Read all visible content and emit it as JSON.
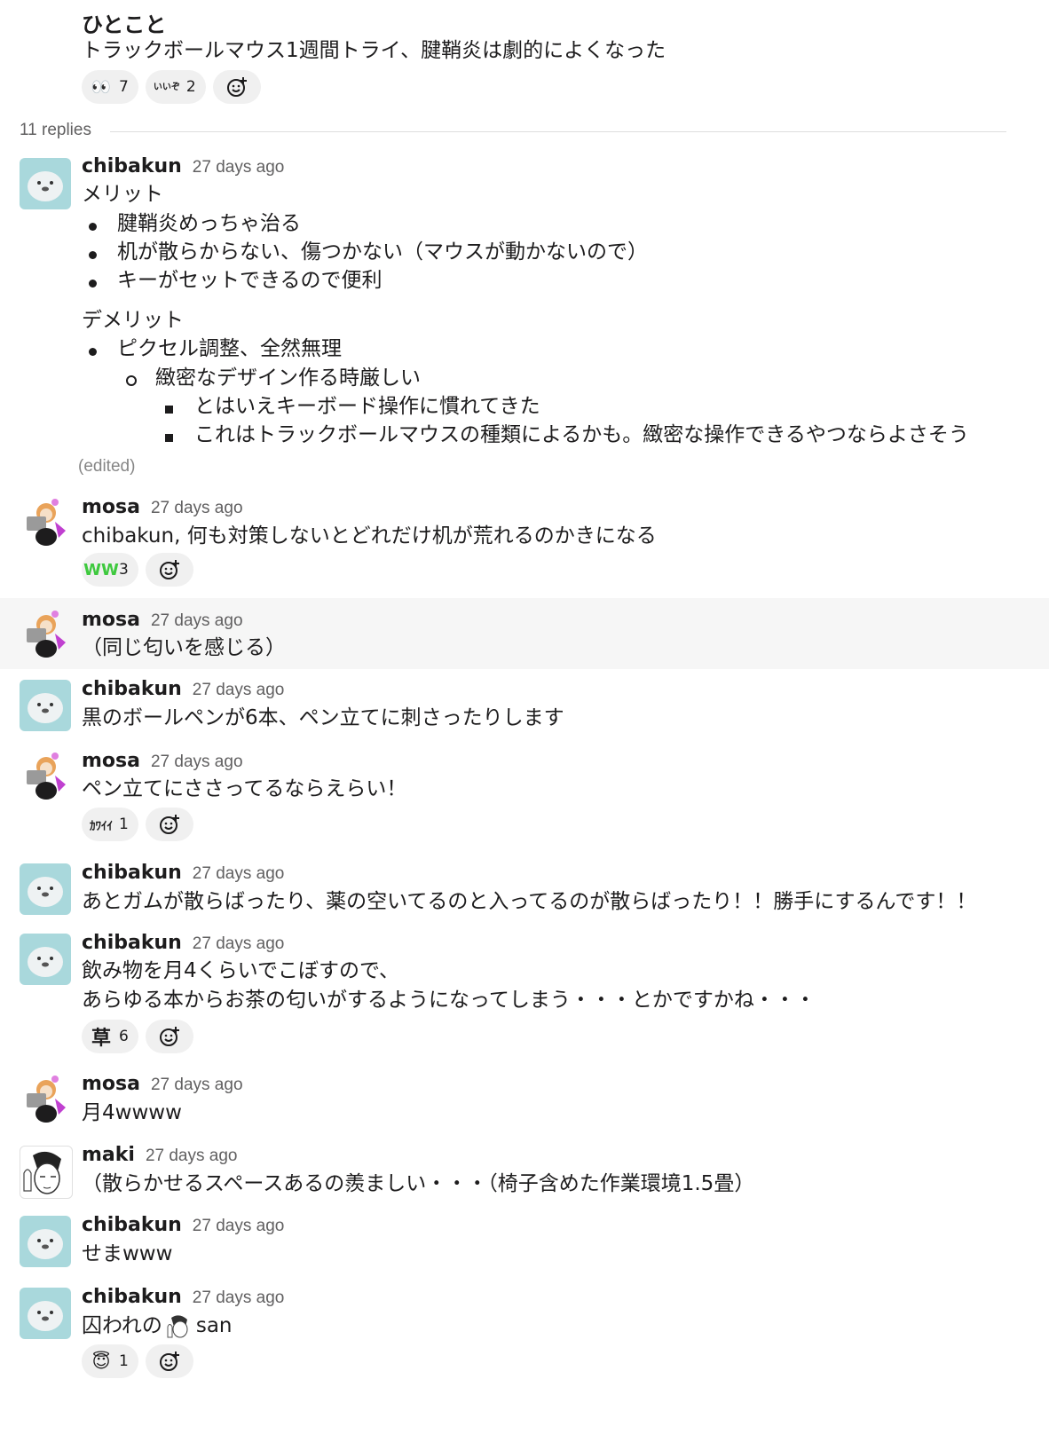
{
  "parent": {
    "name": "ひとこと",
    "text": "トラックボールマウス1週間トライ、腱鞘炎は劇的によくなった",
    "reactions": [
      {
        "icon": "eyes-emoji",
        "glyph": "👀",
        "count": "7"
      },
      {
        "icon": "iiyo-emoji",
        "glyph": "いいぞ",
        "count": "2"
      }
    ]
  },
  "divider": {
    "label": "11 replies"
  },
  "messages": [
    {
      "name": "chibakun",
      "time": "27 days ago",
      "avatar": "seal",
      "section1": "メリット",
      "merits": [
        "腱鞘炎めっちゃ治る",
        "机が散らからない、傷つかない（マウスが動かないので）",
        "キーがセットできるので便利"
      ],
      "section2": "デメリット",
      "demerit_l1": "ピクセル調整、全然無理",
      "demerit_l2": "緻密なデザイン作る時厳しい",
      "demerit_l3": [
        "とはいえキーボード操作に慣れてきた",
        "これはトラックボールマウスの種類によるかも。緻密な操作できるやつならよさそう"
      ],
      "edited": "(edited)"
    },
    {
      "name": "mosa",
      "time": "27 days ago",
      "avatar": "mosa",
      "text": "chibakun, 何も対策しないとどれだけ机が荒れるのかきになる",
      "reactions": [
        {
          "icon": "ww-emoji",
          "glyph": "WW",
          "count": "3"
        }
      ]
    },
    {
      "name": "mosa",
      "time": "27 days ago",
      "avatar": "mosa",
      "text": "（同じ匂いを感じる）"
    },
    {
      "name": "chibakun",
      "time": "27 days ago",
      "avatar": "seal",
      "text": "黒のボールペンが6本、ペン立てに刺さったりします"
    },
    {
      "name": "mosa",
      "time": "27 days ago",
      "avatar": "mosa",
      "text": "ペン立てにささってるならえらい！",
      "reactions": [
        {
          "icon": "kawaii-emoji",
          "glyph": "ｶﾜｲｲ",
          "count": "1"
        }
      ]
    },
    {
      "name": "chibakun",
      "time": "27 days ago",
      "avatar": "seal",
      "text": "あとガムが散らばったり、薬の空いてるのと入ってるのが散らばったり！！勝手にするんです！！"
    },
    {
      "name": "chibakun",
      "time": "27 days ago",
      "avatar": "seal",
      "text": "飲み物を月4くらいでこぼすので、",
      "text2": "あらゆる本からお茶の匂いがするようになってしまう・・・とかですかね・・・",
      "reactions": [
        {
          "icon": "kusa-emoji",
          "glyph": "草",
          "count": "6"
        }
      ]
    },
    {
      "name": "mosa",
      "time": "27 days ago",
      "avatar": "mosa",
      "text": "月4wwww"
    },
    {
      "name": "maki",
      "time": "27 days ago",
      "avatar": "maki",
      "text": "（散らかせるスペースあるの羨ましい・・・（椅子含めた作業環境1.5畳）"
    },
    {
      "name": "chibakun",
      "time": "27 days ago",
      "avatar": "seal",
      "text": "せまwww"
    },
    {
      "name": "chibakun",
      "time": "27 days ago",
      "avatar": "seal",
      "text": "囚われの",
      "text_suffix": "san",
      "reactions": [
        {
          "icon": "innocent-emoji",
          "glyph": "😇",
          "count": "1"
        }
      ]
    }
  ]
}
